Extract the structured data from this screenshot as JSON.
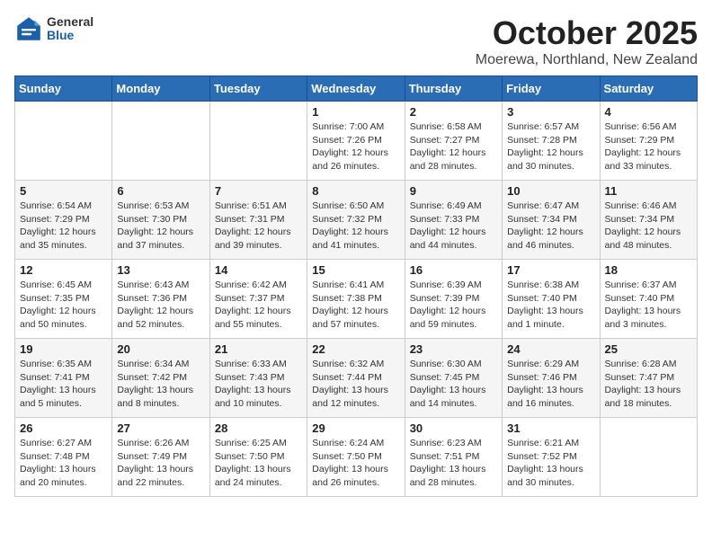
{
  "header": {
    "logo_general": "General",
    "logo_blue": "Blue",
    "month_title": "October 2025",
    "location": "Moerewa, Northland, New Zealand"
  },
  "weekdays": [
    "Sunday",
    "Monday",
    "Tuesday",
    "Wednesday",
    "Thursday",
    "Friday",
    "Saturday"
  ],
  "weeks": [
    [
      {
        "day": "",
        "info": ""
      },
      {
        "day": "",
        "info": ""
      },
      {
        "day": "",
        "info": ""
      },
      {
        "day": "1",
        "info": "Sunrise: 7:00 AM\nSunset: 7:26 PM\nDaylight: 12 hours\nand 26 minutes."
      },
      {
        "day": "2",
        "info": "Sunrise: 6:58 AM\nSunset: 7:27 PM\nDaylight: 12 hours\nand 28 minutes."
      },
      {
        "day": "3",
        "info": "Sunrise: 6:57 AM\nSunset: 7:28 PM\nDaylight: 12 hours\nand 30 minutes."
      },
      {
        "day": "4",
        "info": "Sunrise: 6:56 AM\nSunset: 7:29 PM\nDaylight: 12 hours\nand 33 minutes."
      }
    ],
    [
      {
        "day": "5",
        "info": "Sunrise: 6:54 AM\nSunset: 7:29 PM\nDaylight: 12 hours\nand 35 minutes."
      },
      {
        "day": "6",
        "info": "Sunrise: 6:53 AM\nSunset: 7:30 PM\nDaylight: 12 hours\nand 37 minutes."
      },
      {
        "day": "7",
        "info": "Sunrise: 6:51 AM\nSunset: 7:31 PM\nDaylight: 12 hours\nand 39 minutes."
      },
      {
        "day": "8",
        "info": "Sunrise: 6:50 AM\nSunset: 7:32 PM\nDaylight: 12 hours\nand 41 minutes."
      },
      {
        "day": "9",
        "info": "Sunrise: 6:49 AM\nSunset: 7:33 PM\nDaylight: 12 hours\nand 44 minutes."
      },
      {
        "day": "10",
        "info": "Sunrise: 6:47 AM\nSunset: 7:34 PM\nDaylight: 12 hours\nand 46 minutes."
      },
      {
        "day": "11",
        "info": "Sunrise: 6:46 AM\nSunset: 7:34 PM\nDaylight: 12 hours\nand 48 minutes."
      }
    ],
    [
      {
        "day": "12",
        "info": "Sunrise: 6:45 AM\nSunset: 7:35 PM\nDaylight: 12 hours\nand 50 minutes."
      },
      {
        "day": "13",
        "info": "Sunrise: 6:43 AM\nSunset: 7:36 PM\nDaylight: 12 hours\nand 52 minutes."
      },
      {
        "day": "14",
        "info": "Sunrise: 6:42 AM\nSunset: 7:37 PM\nDaylight: 12 hours\nand 55 minutes."
      },
      {
        "day": "15",
        "info": "Sunrise: 6:41 AM\nSunset: 7:38 PM\nDaylight: 12 hours\nand 57 minutes."
      },
      {
        "day": "16",
        "info": "Sunrise: 6:39 AM\nSunset: 7:39 PM\nDaylight: 12 hours\nand 59 minutes."
      },
      {
        "day": "17",
        "info": "Sunrise: 6:38 AM\nSunset: 7:40 PM\nDaylight: 13 hours\nand 1 minute."
      },
      {
        "day": "18",
        "info": "Sunrise: 6:37 AM\nSunset: 7:40 PM\nDaylight: 13 hours\nand 3 minutes."
      }
    ],
    [
      {
        "day": "19",
        "info": "Sunrise: 6:35 AM\nSunset: 7:41 PM\nDaylight: 13 hours\nand 5 minutes."
      },
      {
        "day": "20",
        "info": "Sunrise: 6:34 AM\nSunset: 7:42 PM\nDaylight: 13 hours\nand 8 minutes."
      },
      {
        "day": "21",
        "info": "Sunrise: 6:33 AM\nSunset: 7:43 PM\nDaylight: 13 hours\nand 10 minutes."
      },
      {
        "day": "22",
        "info": "Sunrise: 6:32 AM\nSunset: 7:44 PM\nDaylight: 13 hours\nand 12 minutes."
      },
      {
        "day": "23",
        "info": "Sunrise: 6:30 AM\nSunset: 7:45 PM\nDaylight: 13 hours\nand 14 minutes."
      },
      {
        "day": "24",
        "info": "Sunrise: 6:29 AM\nSunset: 7:46 PM\nDaylight: 13 hours\nand 16 minutes."
      },
      {
        "day": "25",
        "info": "Sunrise: 6:28 AM\nSunset: 7:47 PM\nDaylight: 13 hours\nand 18 minutes."
      }
    ],
    [
      {
        "day": "26",
        "info": "Sunrise: 6:27 AM\nSunset: 7:48 PM\nDaylight: 13 hours\nand 20 minutes."
      },
      {
        "day": "27",
        "info": "Sunrise: 6:26 AM\nSunset: 7:49 PM\nDaylight: 13 hours\nand 22 minutes."
      },
      {
        "day": "28",
        "info": "Sunrise: 6:25 AM\nSunset: 7:50 PM\nDaylight: 13 hours\nand 24 minutes."
      },
      {
        "day": "29",
        "info": "Sunrise: 6:24 AM\nSunset: 7:50 PM\nDaylight: 13 hours\nand 26 minutes."
      },
      {
        "day": "30",
        "info": "Sunrise: 6:23 AM\nSunset: 7:51 PM\nDaylight: 13 hours\nand 28 minutes."
      },
      {
        "day": "31",
        "info": "Sunrise: 6:21 AM\nSunset: 7:52 PM\nDaylight: 13 hours\nand 30 minutes."
      },
      {
        "day": "",
        "info": ""
      }
    ]
  ]
}
